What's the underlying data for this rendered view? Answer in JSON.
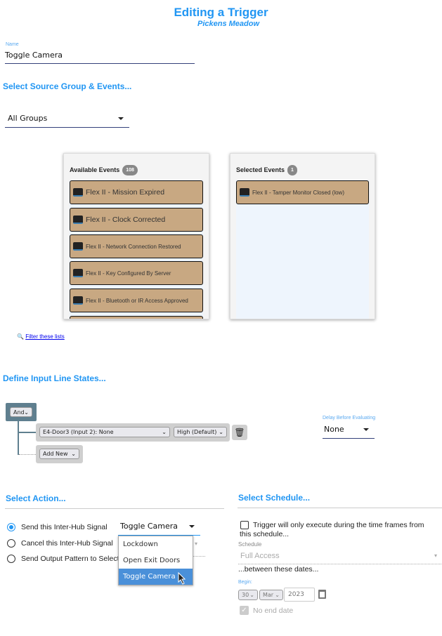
{
  "header": {
    "title": "Editing a Trigger",
    "subtitle": "Pickens Meadow"
  },
  "name_field": {
    "label": "Name",
    "value": "Toggle Camera"
  },
  "source": {
    "heading": "Select Source Group & Events...",
    "group": "All Groups",
    "available": {
      "title": "Available Events",
      "count": "108",
      "items": [
        "Flex II - Mission Expired",
        "Flex II - Clock Corrected",
        "Flex II - Network Connection Restored",
        "Flex II - Key Configured By Server",
        "Flex II - Bluetooth or IR Access Approved"
      ]
    },
    "selected": {
      "title": "Selected Events",
      "count": "1",
      "items": [
        "Flex II - Tamper Monitor Closed (low)"
      ]
    },
    "filter_link": "Filter these lists"
  },
  "input_lines": {
    "heading": "Define Input Line States...",
    "operator": "And",
    "line": "E4-Door3 (Input 2): None",
    "state": "High (Default)",
    "add_new": "Add New",
    "delay_label": "Delay Before Evaluating",
    "delay_value": "None"
  },
  "action": {
    "heading": "Select Action...",
    "options": [
      "Send this Inter-Hub Signal",
      "Cancel this Inter-Hub Signal",
      "Send Output Pattern to Selected Controller"
    ],
    "selected_index": 0,
    "signal": "Toggle Camera",
    "dropdown": [
      "Lockdown",
      "Open Exit Doors",
      "Toggle Camera"
    ],
    "highlighted": "Toggle Camera"
  },
  "schedule": {
    "heading": "Select Schedule...",
    "checkbox": "Trigger will only execute during the time frames from this schedule...",
    "schedule_label": "Schedule",
    "schedule_value": "Full Access",
    "between": "...between these dates...",
    "begin_label": "Begin:",
    "day": "30",
    "month": "Mar",
    "year": "2023",
    "no_end": "No end date",
    "no_end_checked": true
  },
  "colors": {
    "accent": "#2196f3",
    "event_bg": "#c8a882",
    "highlight": "#4a90d9"
  }
}
